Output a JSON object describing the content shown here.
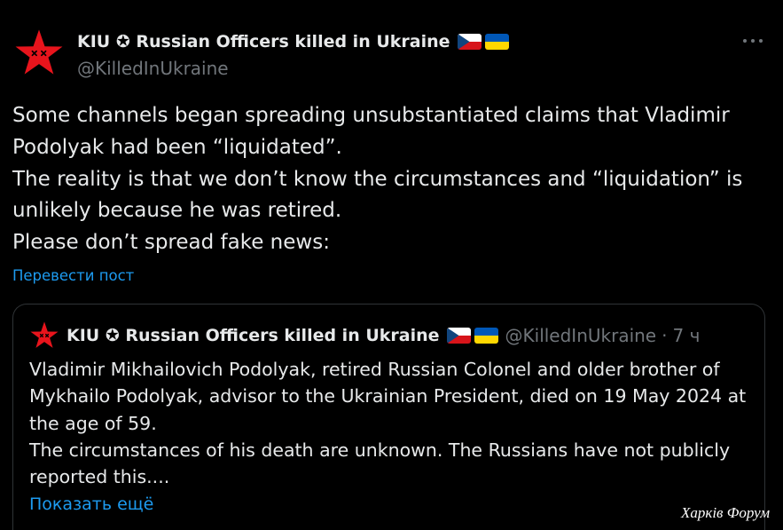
{
  "colors": {
    "background": "#000000",
    "text": "#e7e9ea",
    "secondary": "#71767b",
    "link": "#1d9bf0",
    "border": "#2f3336",
    "star": "#e8141c"
  },
  "post": {
    "author": {
      "avatar_icon": "red-star-icon",
      "display_name": "KIU ✪ Russian Officers killed in Ukraine",
      "flag_icons": [
        "czech-flag-icon",
        "ukraine-flag-icon"
      ],
      "handle": "@KilledInUkraine"
    },
    "more_icon": "more-options-icon",
    "text_lines": [
      "Some channels began spreading unsubstantiated claims that Vladimir",
      "Podolyak had been “liquidated”.",
      "The reality is that we don’t know the circumstances and “liquidation” is",
      "unlikely because he was retired.",
      "Please don’t spread fake news:"
    ],
    "translate_label": "Перевести пост"
  },
  "quote": {
    "author": {
      "avatar_icon": "red-star-icon",
      "display_name": "KIU ✪ Russian Officers killed in Ukraine",
      "flag_icons": [
        "czech-flag-icon",
        "ukraine-flag-icon"
      ],
      "handle": "@KilledInUkraine",
      "separator": "·",
      "time": "7 ч"
    },
    "text_lines": [
      "Vladimir Mikhailovich Podolyak, retired Russian Colonel and older brother of",
      "Mykhailo Podolyak, advisor to the Ukrainian President, died on 19 May 2024 at",
      "the age of 59.",
      "The circumstances of his death are unknown. The Russians have not publicly",
      "reported this...."
    ],
    "show_more_label": "Показать ещё"
  },
  "watermark": "Харків Форум"
}
